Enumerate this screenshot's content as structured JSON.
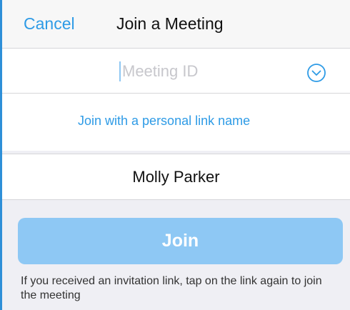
{
  "nav": {
    "cancel_label": "Cancel",
    "title": "Join a Meeting"
  },
  "meeting": {
    "placeholder": "Meeting ID",
    "value": "",
    "dropdown_icon": "chevron-down-circle-icon"
  },
  "personal_link": {
    "label": "Join with a personal link name"
  },
  "name": {
    "value": "Molly Parker"
  },
  "join": {
    "label": "Join"
  },
  "hint": {
    "text": "If you received an invitation link, tap on the link again to join the meeting"
  },
  "colors": {
    "accent": "#2e9be6",
    "join_disabled": "#8ec8f4",
    "background": "#efeff4"
  }
}
